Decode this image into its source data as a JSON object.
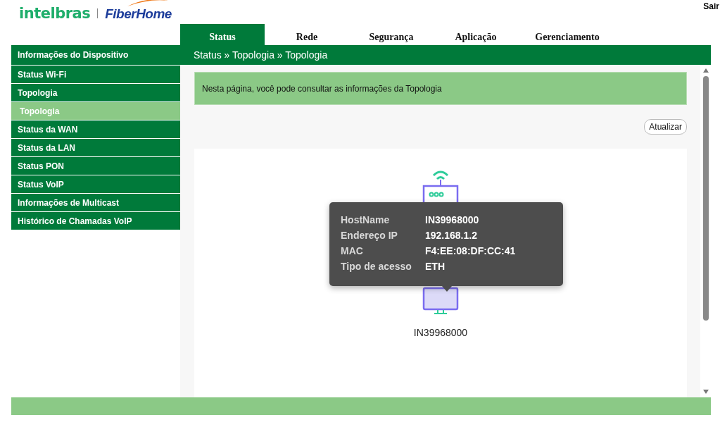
{
  "logo": {
    "brand": "intelbras",
    "partner": "FiberHome"
  },
  "logout": "Sair",
  "tabs": [
    {
      "label": "Status",
      "selected": true
    },
    {
      "label": "Rede",
      "selected": false
    },
    {
      "label": "Segurança",
      "selected": false
    },
    {
      "label": "Aplicação",
      "selected": false
    },
    {
      "label": "Gerenciamento",
      "selected": false
    }
  ],
  "sidebar": {
    "items": [
      {
        "label": "Informações do Dispositivo",
        "kind": "group",
        "selected": false
      },
      {
        "label": "Status Wi-Fi",
        "kind": "group",
        "selected": false
      },
      {
        "label": "Topologia",
        "kind": "group",
        "selected": false
      },
      {
        "label": "Topologia",
        "kind": "sub",
        "selected": true
      },
      {
        "label": "Status da WAN",
        "kind": "group",
        "selected": false
      },
      {
        "label": "Status da LAN",
        "kind": "group",
        "selected": false
      },
      {
        "label": "Status PON",
        "kind": "group",
        "selected": false
      },
      {
        "label": "Status VoIP",
        "kind": "group",
        "selected": false
      },
      {
        "label": "Informações de Multicast",
        "kind": "group",
        "selected": false
      },
      {
        "label": "Histórico de Chamadas VoIP",
        "kind": "group",
        "selected": false
      }
    ]
  },
  "breadcrumb": "Status » Topologia » Topologia",
  "info": "Nesta página, você pode consultar as informações da Topologia",
  "refresh_button": "Atualizar",
  "topology": {
    "device_label": "IN39968000",
    "tooltip": [
      {
        "label": "HostName",
        "value": "IN39968000"
      },
      {
        "label": "Endereço IP",
        "value": "192.168.1.2"
      },
      {
        "label": "MAC",
        "value": "F4:EE:08:DF:CC:41"
      },
      {
        "label": "Tipo de acesso",
        "value": "ETH"
      }
    ]
  }
}
